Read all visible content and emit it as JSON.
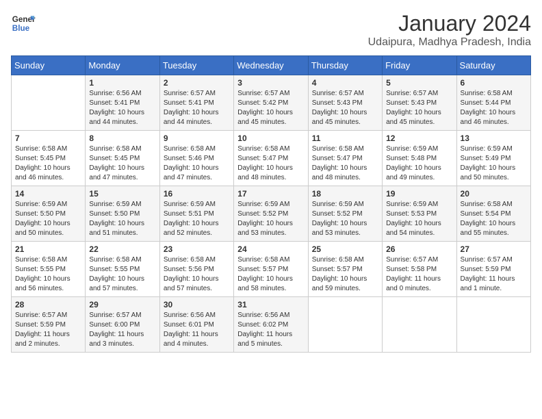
{
  "header": {
    "logo_line1": "General",
    "logo_line2": "Blue",
    "month_year": "January 2024",
    "location": "Udaipura, Madhya Pradesh, India"
  },
  "columns": [
    "Sunday",
    "Monday",
    "Tuesday",
    "Wednesday",
    "Thursday",
    "Friday",
    "Saturday"
  ],
  "weeks": [
    [
      {
        "date": "",
        "sunrise": "",
        "sunset": "",
        "daylight": ""
      },
      {
        "date": "1",
        "sunrise": "Sunrise: 6:56 AM",
        "sunset": "Sunset: 5:41 PM",
        "daylight": "Daylight: 10 hours and 44 minutes."
      },
      {
        "date": "2",
        "sunrise": "Sunrise: 6:57 AM",
        "sunset": "Sunset: 5:41 PM",
        "daylight": "Daylight: 10 hours and 44 minutes."
      },
      {
        "date": "3",
        "sunrise": "Sunrise: 6:57 AM",
        "sunset": "Sunset: 5:42 PM",
        "daylight": "Daylight: 10 hours and 45 minutes."
      },
      {
        "date": "4",
        "sunrise": "Sunrise: 6:57 AM",
        "sunset": "Sunset: 5:43 PM",
        "daylight": "Daylight: 10 hours and 45 minutes."
      },
      {
        "date": "5",
        "sunrise": "Sunrise: 6:57 AM",
        "sunset": "Sunset: 5:43 PM",
        "daylight": "Daylight: 10 hours and 45 minutes."
      },
      {
        "date": "6",
        "sunrise": "Sunrise: 6:58 AM",
        "sunset": "Sunset: 5:44 PM",
        "daylight": "Daylight: 10 hours and 46 minutes."
      }
    ],
    [
      {
        "date": "7",
        "sunrise": "Sunrise: 6:58 AM",
        "sunset": "Sunset: 5:45 PM",
        "daylight": "Daylight: 10 hours and 46 minutes."
      },
      {
        "date": "8",
        "sunrise": "Sunrise: 6:58 AM",
        "sunset": "Sunset: 5:45 PM",
        "daylight": "Daylight: 10 hours and 47 minutes."
      },
      {
        "date": "9",
        "sunrise": "Sunrise: 6:58 AM",
        "sunset": "Sunset: 5:46 PM",
        "daylight": "Daylight: 10 hours and 47 minutes."
      },
      {
        "date": "10",
        "sunrise": "Sunrise: 6:58 AM",
        "sunset": "Sunset: 5:47 PM",
        "daylight": "Daylight: 10 hours and 48 minutes."
      },
      {
        "date": "11",
        "sunrise": "Sunrise: 6:58 AM",
        "sunset": "Sunset: 5:47 PM",
        "daylight": "Daylight: 10 hours and 48 minutes."
      },
      {
        "date": "12",
        "sunrise": "Sunrise: 6:59 AM",
        "sunset": "Sunset: 5:48 PM",
        "daylight": "Daylight: 10 hours and 49 minutes."
      },
      {
        "date": "13",
        "sunrise": "Sunrise: 6:59 AM",
        "sunset": "Sunset: 5:49 PM",
        "daylight": "Daylight: 10 hours and 50 minutes."
      }
    ],
    [
      {
        "date": "14",
        "sunrise": "Sunrise: 6:59 AM",
        "sunset": "Sunset: 5:50 PM",
        "daylight": "Daylight: 10 hours and 50 minutes."
      },
      {
        "date": "15",
        "sunrise": "Sunrise: 6:59 AM",
        "sunset": "Sunset: 5:50 PM",
        "daylight": "Daylight: 10 hours and 51 minutes."
      },
      {
        "date": "16",
        "sunrise": "Sunrise: 6:59 AM",
        "sunset": "Sunset: 5:51 PM",
        "daylight": "Daylight: 10 hours and 52 minutes."
      },
      {
        "date": "17",
        "sunrise": "Sunrise: 6:59 AM",
        "sunset": "Sunset: 5:52 PM",
        "daylight": "Daylight: 10 hours and 53 minutes."
      },
      {
        "date": "18",
        "sunrise": "Sunrise: 6:59 AM",
        "sunset": "Sunset: 5:52 PM",
        "daylight": "Daylight: 10 hours and 53 minutes."
      },
      {
        "date": "19",
        "sunrise": "Sunrise: 6:59 AM",
        "sunset": "Sunset: 5:53 PM",
        "daylight": "Daylight: 10 hours and 54 minutes."
      },
      {
        "date": "20",
        "sunrise": "Sunrise: 6:58 AM",
        "sunset": "Sunset: 5:54 PM",
        "daylight": "Daylight: 10 hours and 55 minutes."
      }
    ],
    [
      {
        "date": "21",
        "sunrise": "Sunrise: 6:58 AM",
        "sunset": "Sunset: 5:55 PM",
        "daylight": "Daylight: 10 hours and 56 minutes."
      },
      {
        "date": "22",
        "sunrise": "Sunrise: 6:58 AM",
        "sunset": "Sunset: 5:55 PM",
        "daylight": "Daylight: 10 hours and 57 minutes."
      },
      {
        "date": "23",
        "sunrise": "Sunrise: 6:58 AM",
        "sunset": "Sunset: 5:56 PM",
        "daylight": "Daylight: 10 hours and 57 minutes."
      },
      {
        "date": "24",
        "sunrise": "Sunrise: 6:58 AM",
        "sunset": "Sunset: 5:57 PM",
        "daylight": "Daylight: 10 hours and 58 minutes."
      },
      {
        "date": "25",
        "sunrise": "Sunrise: 6:58 AM",
        "sunset": "Sunset: 5:57 PM",
        "daylight": "Daylight: 10 hours and 59 minutes."
      },
      {
        "date": "26",
        "sunrise": "Sunrise: 6:57 AM",
        "sunset": "Sunset: 5:58 PM",
        "daylight": "Daylight: 11 hours and 0 minutes."
      },
      {
        "date": "27",
        "sunrise": "Sunrise: 6:57 AM",
        "sunset": "Sunset: 5:59 PM",
        "daylight": "Daylight: 11 hours and 1 minute."
      }
    ],
    [
      {
        "date": "28",
        "sunrise": "Sunrise: 6:57 AM",
        "sunset": "Sunset: 5:59 PM",
        "daylight": "Daylight: 11 hours and 2 minutes."
      },
      {
        "date": "29",
        "sunrise": "Sunrise: 6:57 AM",
        "sunset": "Sunset: 6:00 PM",
        "daylight": "Daylight: 11 hours and 3 minutes."
      },
      {
        "date": "30",
        "sunrise": "Sunrise: 6:56 AM",
        "sunset": "Sunset: 6:01 PM",
        "daylight": "Daylight: 11 hours and 4 minutes."
      },
      {
        "date": "31",
        "sunrise": "Sunrise: 6:56 AM",
        "sunset": "Sunset: 6:02 PM",
        "daylight": "Daylight: 11 hours and 5 minutes."
      },
      {
        "date": "",
        "sunrise": "",
        "sunset": "",
        "daylight": ""
      },
      {
        "date": "",
        "sunrise": "",
        "sunset": "",
        "daylight": ""
      },
      {
        "date": "",
        "sunrise": "",
        "sunset": "",
        "daylight": ""
      }
    ]
  ]
}
